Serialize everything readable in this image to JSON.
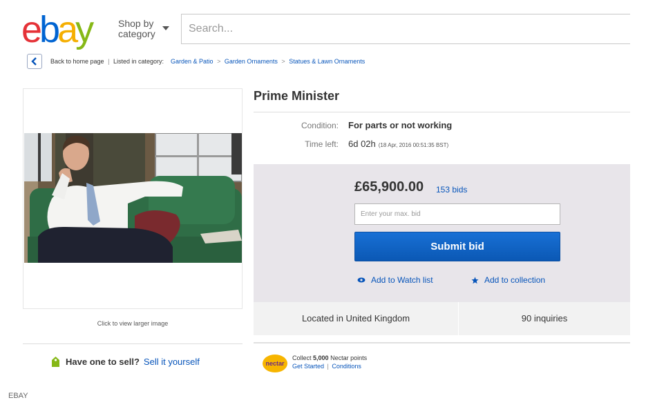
{
  "header": {
    "logo_letters": [
      "e",
      "b",
      "a",
      "y"
    ],
    "logo_colors": [
      "#e53238",
      "#0064d2",
      "#f5af02",
      "#86b817"
    ],
    "shop_by_line1": "Shop by",
    "shop_by_line2": "category",
    "search_placeholder": "Search..."
  },
  "breadcrumb": {
    "back_label": "Back to home page",
    "listed_label": "Listed in category:",
    "items": [
      "Garden & Patio",
      "Garden Ornaments",
      "Statues & Lawn Ornaments"
    ]
  },
  "gallery": {
    "click_text": "Click to view larger image"
  },
  "sell": {
    "question": "Have one to sell?",
    "link": "Sell it yourself"
  },
  "item": {
    "title": "Prime Minister",
    "condition_label": "Condition:",
    "condition_value": "For parts or not working",
    "time_label": "Time left:",
    "time_value": "6d 02h",
    "time_detail": "(18 Apr, 2016  00:51:35 BST)"
  },
  "bid": {
    "price": "£65,900.00",
    "bids": "153 bids",
    "input_placeholder": "Enter your max. bid",
    "submit_label": "Submit bid",
    "watch_label": "Add to Watch list",
    "collection_label": "Add to collection",
    "accent_color": "#0654ba"
  },
  "location": {
    "located": "Located in United Kingdom",
    "inquiries": "90 inquiries"
  },
  "nectar": {
    "logo_text": "nectar",
    "line1_prefix": "Collect",
    "line1_points": "5,000",
    "line1_suffix": "Nectar points",
    "get_started": "Get Started",
    "conditions": "Conditions"
  },
  "credit": "EBAY"
}
